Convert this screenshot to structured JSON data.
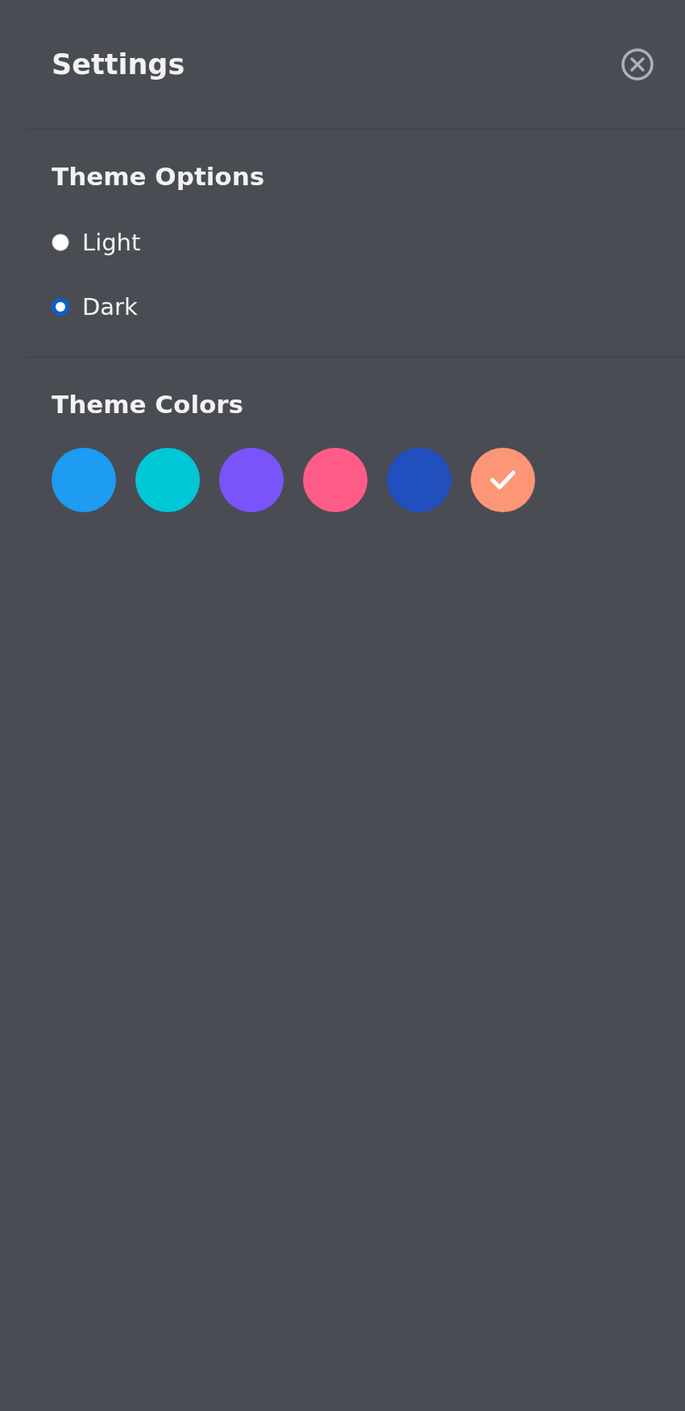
{
  "panel": {
    "title": "Settings"
  },
  "theme_options": {
    "heading": "Theme Options",
    "options": [
      {
        "label": "Light",
        "selected": false
      },
      {
        "label": "Dark",
        "selected": true
      }
    ]
  },
  "theme_colors": {
    "heading": "Theme Colors",
    "swatches": [
      {
        "color": "#1e9bf2",
        "selected": false
      },
      {
        "color": "#00c7d6",
        "selected": false
      },
      {
        "color": "#7a54fb",
        "selected": false
      },
      {
        "color": "#ff5c8a",
        "selected": false
      },
      {
        "color": "#214fbd",
        "selected": false
      },
      {
        "color": "#fd9676",
        "selected": true
      }
    ]
  }
}
